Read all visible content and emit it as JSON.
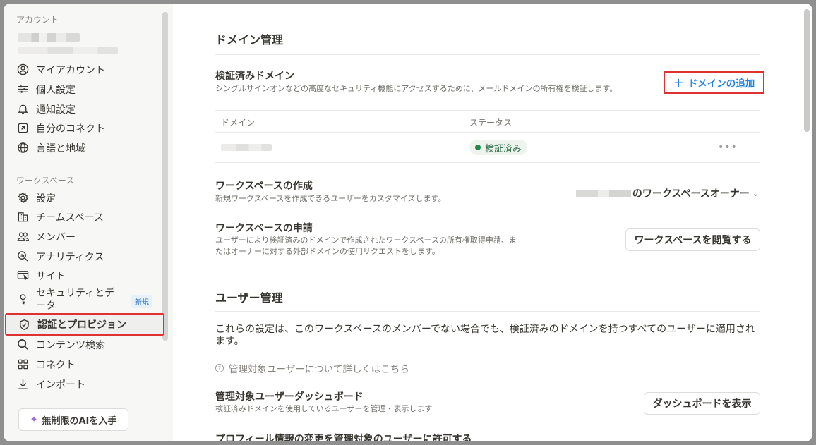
{
  "sidebar": {
    "account_label": "アカウント",
    "account_items": [
      {
        "label": "マイアカウント",
        "icon": "user-circle-icon"
      },
      {
        "label": "個人設定",
        "icon": "sliders-icon"
      },
      {
        "label": "通知設定",
        "icon": "bell-icon"
      },
      {
        "label": "自分のコネクト",
        "icon": "arrow-up-right-box-icon"
      },
      {
        "label": "言語と地域",
        "icon": "globe-icon"
      }
    ],
    "workspace_label": "ワークスペース",
    "workspace_items": [
      {
        "label": "設定",
        "icon": "gear-icon"
      },
      {
        "label": "チームスペース",
        "icon": "building-icon"
      },
      {
        "label": "メンバー",
        "icon": "people-icon"
      },
      {
        "label": "アナリティクス",
        "icon": "magnify-chart-icon"
      },
      {
        "label": "サイト",
        "icon": "browser-icon"
      },
      {
        "label": "セキュリティとデータ",
        "icon": "key-icon",
        "badge": "新規"
      },
      {
        "label": "認証とプロビジョン",
        "icon": "shield-check-icon",
        "active": true
      },
      {
        "label": "コンテンツ検索",
        "icon": "search-icon"
      },
      {
        "label": "コネクト",
        "icon": "grid-icon"
      },
      {
        "label": "インポート",
        "icon": "download-icon"
      }
    ],
    "upgrade_label": "無制限のAIを入手"
  },
  "main": {
    "domain_section": {
      "title": "ドメイン管理",
      "verified_title": "検証済みドメイン",
      "verified_desc": "シングルサインオンなどの高度なセキュリティ機能にアクセスするために、メールドメインの所有権を検証します。",
      "add_button": "ドメインの追加",
      "columns": [
        "ドメイン",
        "ステータス"
      ],
      "rows": [
        {
          "status": "検証済み",
          "more": "•••"
        }
      ]
    },
    "workspace_creation": {
      "title": "ワークスペースの作成",
      "desc": "新規ワークスペースを作成できるユーザーをカスタマイズします。",
      "select_value": "のワークスペースオーナー",
      "chevron": "⌄"
    },
    "workspace_request": {
      "title": "ワークスペースの申請",
      "desc_line1": "ユーザーにより検証済みのドメインで作成されたワークスペースの所有権取得申請、ま",
      "desc_line2": "たはオーナーに対する外部ドメインの使用リクエストをします。",
      "button": "ワークスペースを閲覧する"
    },
    "user_section": {
      "title": "ユーザー管理",
      "para_line1": "これらの設定は、このワークスペースのメンバーでない場合でも、検証済みのドメインを持つすべてのユーザーに適用され",
      "para_line2": "ます。",
      "help_link": "管理対象ユーザーについて詳しくはこちら",
      "help_icon": "?",
      "dashboard_title": "管理対象ユーザーダッシュボード",
      "dashboard_desc": "検証済みドメインを使用しているユーザーを管理・表示します",
      "dashboard_button": "ダッシュボードを表示",
      "profile_title": "プロフィール情報の変更を管理対象のユーザーに許可する"
    }
  }
}
